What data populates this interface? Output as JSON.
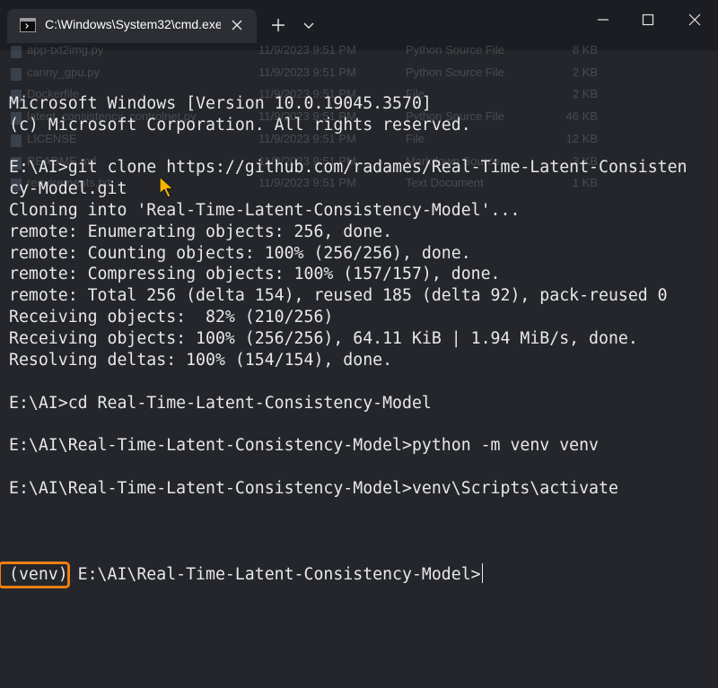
{
  "window": {
    "tab_title": "C:\\Windows\\System32\\cmd.exe",
    "tab_icon": "terminal-icon",
    "buttons": {
      "close_tab": "close-icon",
      "new_tab": "plus-icon",
      "tab_dropdown": "chevron-down-icon",
      "minimize": "minimize-icon",
      "maximize": "maximize-icon",
      "close_window": "close-icon"
    }
  },
  "background_files": [
    {
      "name": "app-txt2img.py",
      "date": "11/9/2023 9:51 PM",
      "type": "Python Source File",
      "size": "8 KB"
    },
    {
      "name": "canny_gpu.py",
      "date": "11/9/2023 9:51 PM",
      "type": "Python Source File",
      "size": "2 KB"
    },
    {
      "name": "Dockerfile",
      "date": "11/9/2023 9:51 PM",
      "type": "File",
      "size": "2 KB"
    },
    {
      "name": "latent_consistency_controlnet.py",
      "date": "11/9/2023 9:51 PM",
      "type": "Python Source File",
      "size": "46 KB"
    },
    {
      "name": "LICENSE",
      "date": "11/9/2023 9:51 PM",
      "type": "File",
      "size": "12 KB"
    },
    {
      "name": "README.md",
      "date": "11/9/2023 9:51 PM",
      "type": "Markdown Source ...",
      "size": "3 KB"
    },
    {
      "name": "requirements.txt",
      "date": "11/9/2023 9:51 PM",
      "type": "Text Document",
      "size": "1 KB"
    }
  ],
  "console": {
    "lines": [
      "Microsoft Windows [Version 10.0.19045.3570]",
      "(c) Microsoft Corporation. All rights reserved.",
      "",
      "E:\\AI>git clone https://github.com/radames/Real-Time-Latent-Consisten",
      "cy-Model.git",
      "Cloning into 'Real-Time-Latent-Consistency-Model'...",
      "remote: Enumerating objects: 256, done.",
      "remote: Counting objects: 100% (256/256), done.",
      "remote: Compressing objects: 100% (157/157), done.",
      "remote: Total 256 (delta 154), reused 185 (delta 92), pack-reused 0",
      "Receiving objects:  82% (210/256)",
      "Receiving objects: 100% (256/256), 64.11 KiB | 1.94 MiB/s, done.",
      "Resolving deltas: 100% (154/154), done.",
      "",
      "E:\\AI>cd Real-Time-Latent-Consistency-Model",
      "",
      "E:\\AI\\Real-Time-Latent-Consistency-Model>python -m venv venv",
      "",
      "E:\\AI\\Real-Time-Latent-Consistency-Model>venv\\Scripts\\activate",
      ""
    ],
    "prompt_venv": "(venv)",
    "prompt_path": " E:\\AI\\Real-Time-Latent-Consistency-Model>"
  },
  "colors": {
    "background": "#24262c",
    "text": "#e8e8e8",
    "highlight": "#f07e10",
    "pointer": "#f5b400"
  }
}
